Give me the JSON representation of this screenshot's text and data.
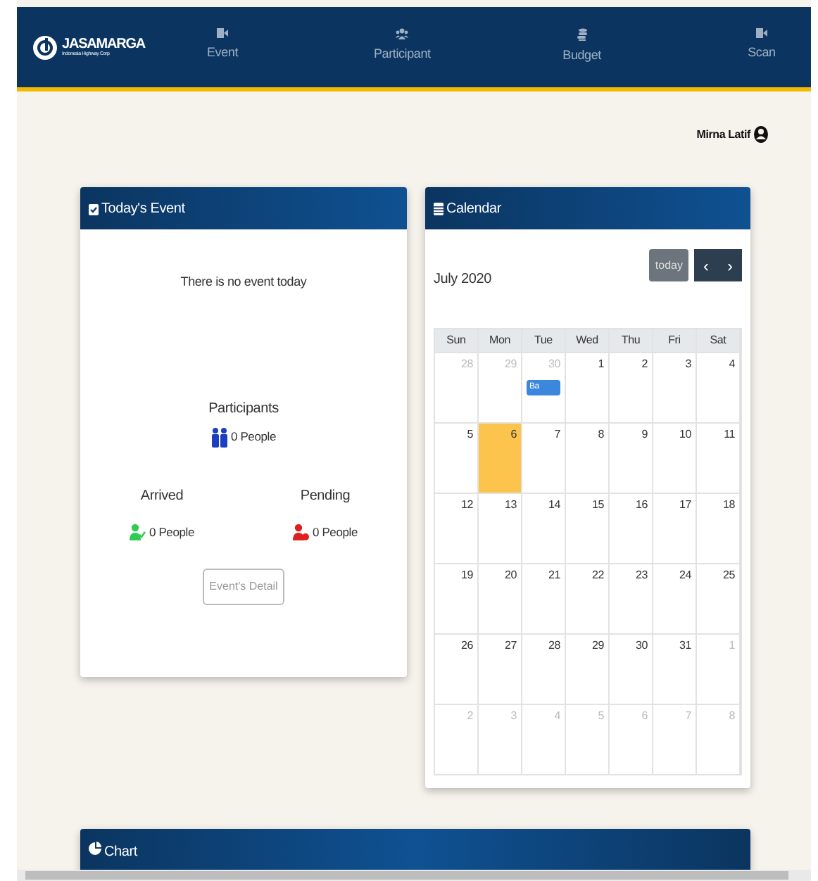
{
  "navbar": {
    "brand": "JASAMARGA",
    "tagline": "Indonesia Highway Corp",
    "items": [
      {
        "label": "Event",
        "kind": "video"
      },
      {
        "label": "Participant",
        "kind": "people"
      },
      {
        "label": "Budget",
        "kind": "coins"
      },
      {
        "label": "Scan",
        "kind": "video"
      }
    ]
  },
  "user": {
    "name": "Mirna Latif"
  },
  "today_card": {
    "title": "Today's Event",
    "message": "There is no event today",
    "participants": {
      "label": "Participants",
      "count": "0 People"
    },
    "arrived": {
      "label": "Arrived",
      "count": "0 People"
    },
    "pending": {
      "label": "Pending",
      "count": "0 People"
    },
    "button": "Event's Detail"
  },
  "calendar": {
    "title": "Calendar",
    "month": "July 2020",
    "today_button": "today",
    "prev": "‹",
    "next": "›",
    "weekdays": [
      "Sun",
      "Mon",
      "Tue",
      "Wed",
      "Thu",
      "Fri",
      "Sat"
    ],
    "weeks": [
      [
        {
          "day": "28",
          "other_month": true,
          "today": false
        },
        {
          "day": "29",
          "other_month": true,
          "today": false
        },
        {
          "day": "30",
          "other_month": true,
          "today": false,
          "event": "Ba"
        },
        {
          "day": "1",
          "other_month": false,
          "today": false
        },
        {
          "day": "2",
          "other_month": false,
          "today": false
        },
        {
          "day": "3",
          "other_month": false,
          "today": false
        },
        {
          "day": "4",
          "other_month": false,
          "today": false
        }
      ],
      [
        {
          "day": "5",
          "other_month": false,
          "today": false
        },
        {
          "day": "6",
          "other_month": false,
          "today": true
        },
        {
          "day": "7",
          "other_month": false,
          "today": false
        },
        {
          "day": "8",
          "other_month": false,
          "today": false
        },
        {
          "day": "9",
          "other_month": false,
          "today": false
        },
        {
          "day": "10",
          "other_month": false,
          "today": false
        },
        {
          "day": "11",
          "other_month": false,
          "today": false
        }
      ],
      [
        {
          "day": "12",
          "other_month": false,
          "today": false
        },
        {
          "day": "13",
          "other_month": false,
          "today": false
        },
        {
          "day": "14",
          "other_month": false,
          "today": false
        },
        {
          "day": "15",
          "other_month": false,
          "today": false
        },
        {
          "day": "16",
          "other_month": false,
          "today": false
        },
        {
          "day": "17",
          "other_month": false,
          "today": false
        },
        {
          "day": "18",
          "other_month": false,
          "today": false
        }
      ],
      [
        {
          "day": "19",
          "other_month": false,
          "today": false
        },
        {
          "day": "20",
          "other_month": false,
          "today": false
        },
        {
          "day": "21",
          "other_month": false,
          "today": false
        },
        {
          "day": "22",
          "other_month": false,
          "today": false
        },
        {
          "day": "23",
          "other_month": false,
          "today": false
        },
        {
          "day": "24",
          "other_month": false,
          "today": false
        },
        {
          "day": "25",
          "other_month": false,
          "today": false
        }
      ],
      [
        {
          "day": "26",
          "other_month": false,
          "today": false
        },
        {
          "day": "27",
          "other_month": false,
          "today": false
        },
        {
          "day": "28",
          "other_month": false,
          "today": false
        },
        {
          "day": "29",
          "other_month": false,
          "today": false
        },
        {
          "day": "30",
          "other_month": false,
          "today": false
        },
        {
          "day": "31",
          "other_month": false,
          "today": false
        },
        {
          "day": "1",
          "other_month": true,
          "today": false
        }
      ],
      [
        {
          "day": "2",
          "other_month": true,
          "today": false
        },
        {
          "day": "3",
          "other_month": true,
          "today": false
        },
        {
          "day": "4",
          "other_month": true,
          "today": false
        },
        {
          "day": "5",
          "other_month": true,
          "today": false
        },
        {
          "day": "6",
          "other_month": true,
          "today": false
        },
        {
          "day": "7",
          "other_month": true,
          "today": false
        },
        {
          "day": "8",
          "other_month": true,
          "today": false
        }
      ]
    ]
  },
  "chart_card": {
    "title": "Chart"
  }
}
